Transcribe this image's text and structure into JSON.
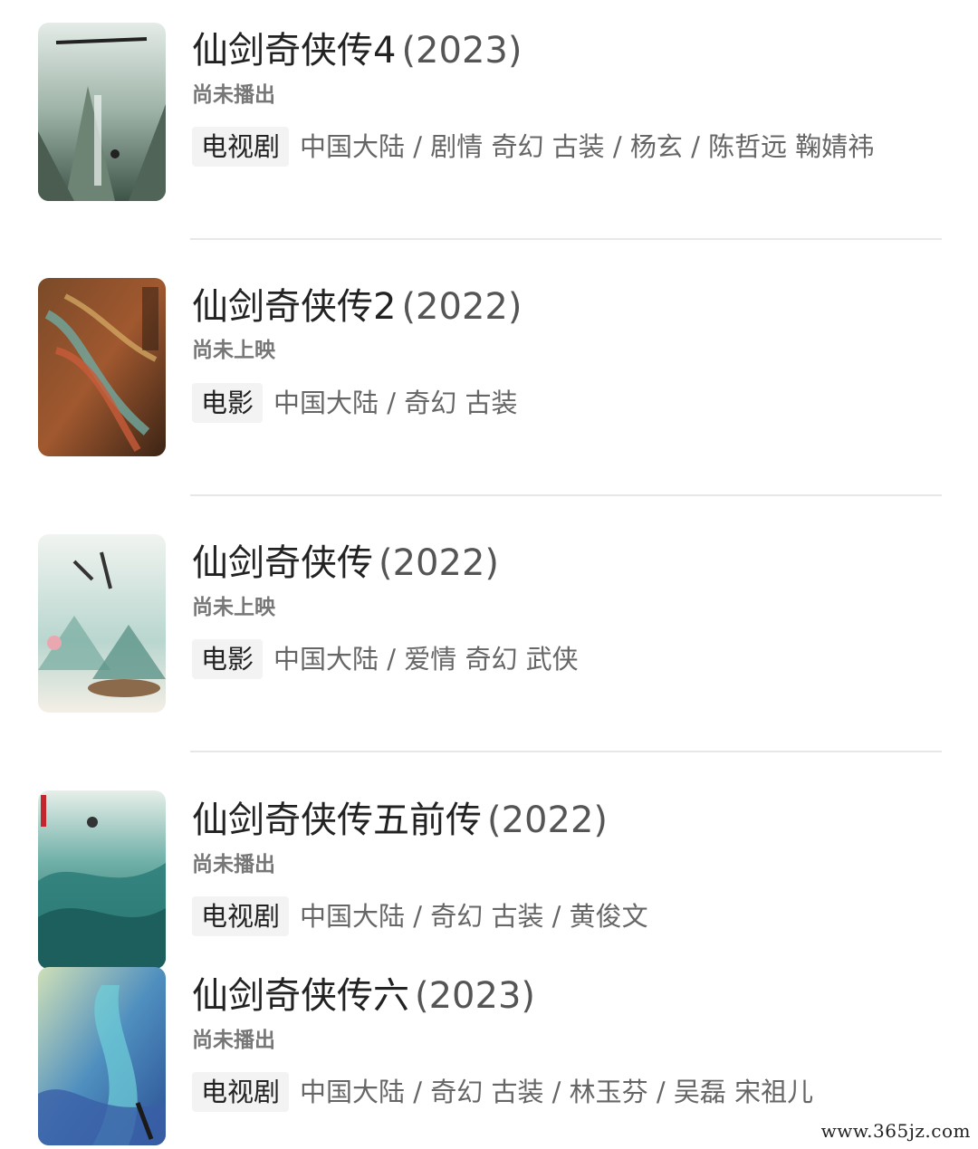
{
  "results": [
    {
      "title": "仙剑奇侠传4",
      "year": "(2023)",
      "status": "尚未播出",
      "type": "电视剧",
      "meta": "中国大陆 / 剧情 奇幻 古装 / 杨玄 / 陈哲远 鞠婧祎"
    },
    {
      "title": "仙剑奇侠传2",
      "year": "(2022)",
      "status": "尚未上映",
      "type": "电影",
      "meta": "中国大陆 / 奇幻 古装"
    },
    {
      "title": "仙剑奇侠传",
      "year": "(2022)",
      "status": "尚未上映",
      "type": "电影",
      "meta": "中国大陆 / 爱情 奇幻 武侠"
    },
    {
      "title": "仙剑奇侠传五前传",
      "year": "(2022)",
      "status": "尚未播出",
      "type": "电视剧",
      "meta": "中国大陆 / 奇幻 古装 / 黄俊文"
    },
    {
      "title": "仙剑奇侠传六",
      "year": "(2023)",
      "status": "尚未播出",
      "type": "电视剧",
      "meta": "中国大陆 / 奇幻 古装 / 林玉芬 / 吴磊 宋祖儿"
    }
  ],
  "watermark": "www.365jz.com"
}
